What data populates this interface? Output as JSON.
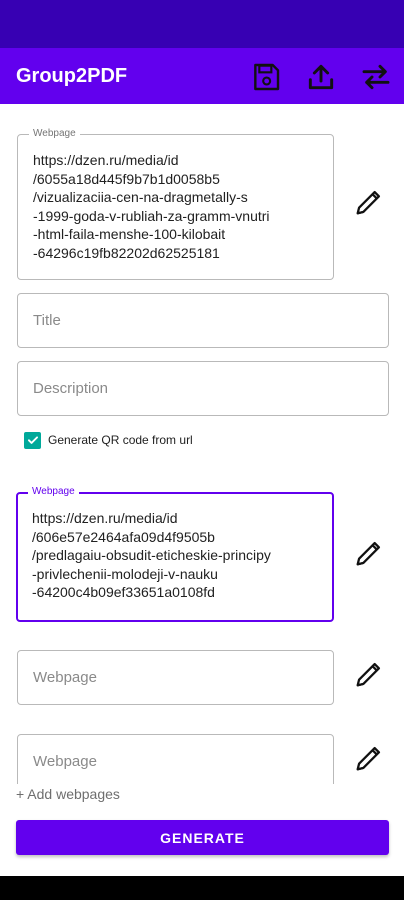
{
  "app": {
    "title": "Group2PDF",
    "actions": {
      "save_icon": "save-icon",
      "share_icon": "share-icon",
      "swap_icon": "swap-icon"
    }
  },
  "group1": {
    "webpage_label": "Webpage",
    "webpage_value": "https://dzen.ru/media/id\n/6055a18d445f9b7b1d0058b5\n/vizualizaciia-cen-na-dragmetally-s\n-1999-goda-v-rubliah-za-gramm-vnutri\n-html-faila-menshe-100-kilobait\n-64296c19fb82202d62525181",
    "title_placeholder": "Title",
    "description_placeholder": "Description",
    "qr_checkbox_label": "Generate QR code from url",
    "qr_checked": true
  },
  "webpages": [
    {
      "label": "Webpage",
      "value": "https://dzen.ru/media/id\n/606e57e2464afa09d4f9505b\n/predlagaiu-obsudit-eticheskie-principy\n-privlechenii-molodeji-v-nauku\n-64200c4b09ef33651a0108fd"
    },
    {
      "placeholder": "Webpage"
    },
    {
      "placeholder": "Webpage"
    }
  ],
  "add_webpages_label": "+ Add webpages",
  "generate_label": "GENERATE",
  "colors": {
    "primary": "#6200ee",
    "status_bar": "#3700b3",
    "checkbox": "#00a99a"
  }
}
